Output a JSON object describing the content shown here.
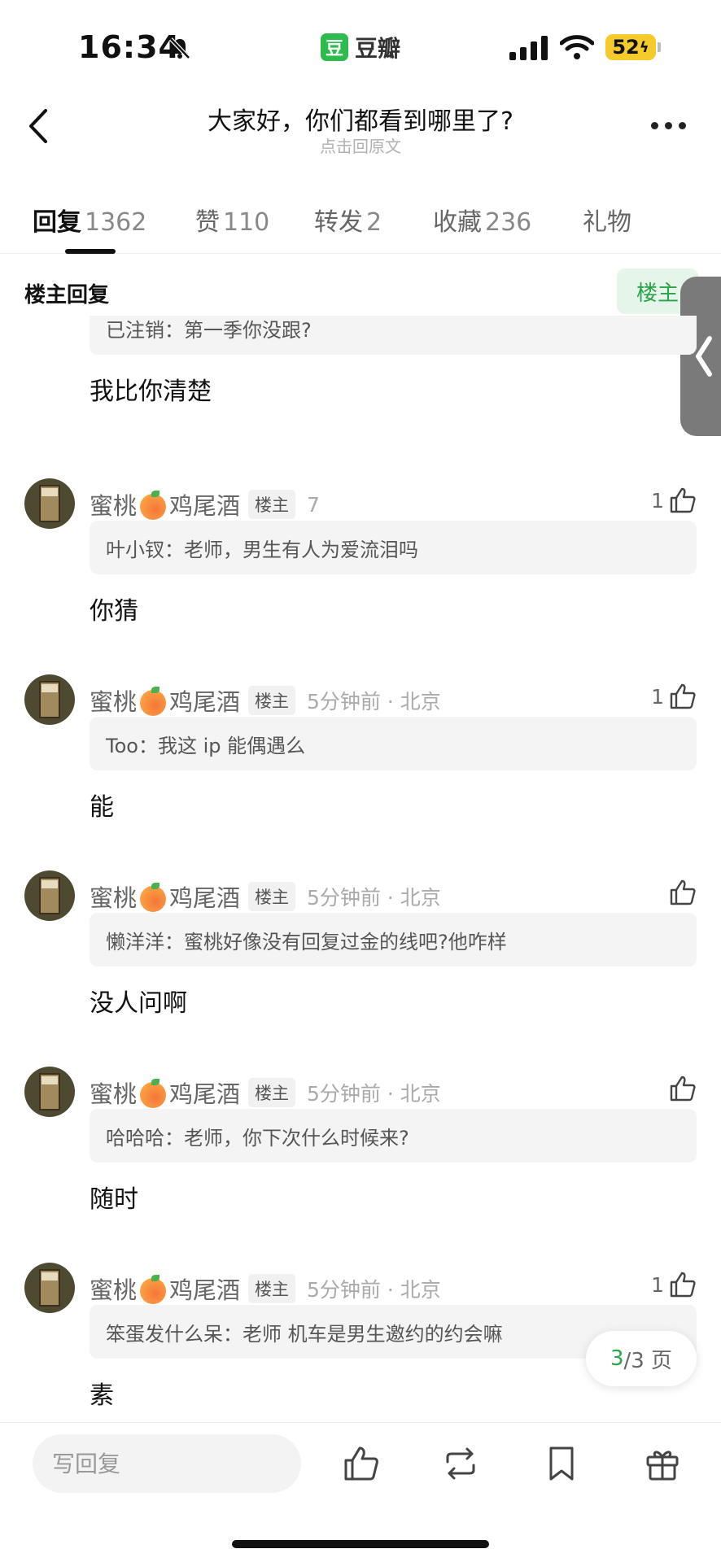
{
  "status_bar": {
    "time": "16:34",
    "app_logo": "豆",
    "app_name": "豆瓣",
    "battery": "52"
  },
  "nav": {
    "title": "大家好，你们都看到哪里了?",
    "subtitle": "点击回原文"
  },
  "tabs": [
    {
      "label": "回复",
      "count": "1362"
    },
    {
      "label": "赞",
      "count": "110"
    },
    {
      "label": "转发",
      "count": "2"
    },
    {
      "label": "收藏",
      "count": "236"
    },
    {
      "label": "礼物",
      "count": ""
    }
  ],
  "filter": {
    "label": "楼主回复",
    "chip": "楼主"
  },
  "comments": [
    {
      "author": "",
      "badge": "",
      "time": "",
      "likes": "",
      "quote": "已注销：第一季你没跟?",
      "text": "我比你清楚"
    },
    {
      "author_a": "蜜桃",
      "author_b": "鸡尾酒",
      "badge": "楼主",
      "time": "7",
      "likes": "1",
      "quote": "叶小钗：老师，男生有人为爱流泪吗",
      "text": "你猜"
    },
    {
      "author_a": "蜜桃",
      "author_b": "鸡尾酒",
      "badge": "楼主",
      "time": "5分钟前 · 北京",
      "likes": "1",
      "quote": "Too：我这 ip 能偶遇么",
      "text": "能"
    },
    {
      "author_a": "蜜桃",
      "author_b": "鸡尾酒",
      "badge": "楼主",
      "time": "5分钟前 · 北京",
      "likes": "",
      "quote": "懒洋洋：蜜桃好像没有回复过金的线吧?他咋样",
      "text": "没人问啊"
    },
    {
      "author_a": "蜜桃",
      "author_b": "鸡尾酒",
      "badge": "楼主",
      "time": "5分钟前 · 北京",
      "likes": "",
      "quote": "哈哈哈：老师，你下次什么时候来?",
      "text": "随时"
    },
    {
      "author_a": "蜜桃",
      "author_b": "鸡尾酒",
      "badge": "楼主",
      "time": "5分钟前 · 北京",
      "likes": "1",
      "quote": "笨蛋发什么呆：老师 机车是男生邀约的约会嘛",
      "text": "素"
    }
  ],
  "pager": {
    "current": "3",
    "total": "/3 页"
  },
  "bottom": {
    "reply_placeholder": "写回复"
  },
  "colors": {
    "accent": "#2aa34a",
    "op_chip_bg": "#e6f5e9"
  },
  "icons": [
    "bell-mute-icon",
    "signal-icon",
    "wifi-icon",
    "back-icon",
    "more-icon",
    "thumbs-up-icon",
    "repost-icon",
    "bookmark-icon",
    "gift-icon",
    "peach-icon"
  ]
}
